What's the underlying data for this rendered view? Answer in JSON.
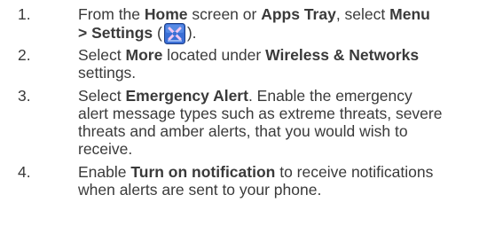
{
  "steps": [
    {
      "number": "1.",
      "lines": [
        {
          "parts": [
            {
              "t": "From the ",
              "b": false
            },
            {
              "t": "Home",
              "b": true
            },
            {
              "t": " screen or ",
              "b": false
            },
            {
              "t": "Apps Tray",
              "b": true
            },
            {
              "t": ", select ",
              "b": false
            },
            {
              "t": "Menu",
              "b": true
            }
          ]
        },
        {
          "parts": [
            {
              "t": "> Settings",
              "b": true
            },
            {
              "t": " (",
              "b": false
            },
            {
              "icon": "settings-icon"
            },
            {
              "t": ").",
              "b": false
            }
          ]
        }
      ]
    },
    {
      "number": "2.",
      "lines": [
        {
          "parts": [
            {
              "t": "Select ",
              "b": false
            },
            {
              "t": "More",
              "b": true
            },
            {
              "t": " located under ",
              "b": false
            },
            {
              "t": "Wireless & Networks",
              "b": true
            }
          ]
        },
        {
          "parts": [
            {
              "t": "settings.",
              "b": false
            }
          ]
        }
      ]
    },
    {
      "number": "3.",
      "lines": [
        {
          "parts": [
            {
              "t": "Select ",
              "b": false
            },
            {
              "t": "Emergency Alert",
              "b": true
            },
            {
              "t": ". Enable the emergency",
              "b": false
            }
          ]
        },
        {
          "parts": [
            {
              "t": "alert message types such as extreme threats, severe",
              "b": false
            }
          ]
        },
        {
          "parts": [
            {
              "t": "threats and amber alerts, that you would wish to",
              "b": false
            }
          ]
        },
        {
          "parts": [
            {
              "t": "receive.",
              "b": false
            }
          ]
        }
      ]
    },
    {
      "number": "4.",
      "lines": [
        {
          "parts": [
            {
              "t": "Enable ",
              "b": false
            },
            {
              "t": "Turn on notification",
              "b": true
            },
            {
              "t": " to receive notifications",
              "b": false
            }
          ]
        },
        {
          "parts": [
            {
              "t": "when alerts are sent to your phone.",
              "b": false
            }
          ]
        }
      ]
    }
  ],
  "colors": {
    "text": "#3a3a3a",
    "icon_bg": "#3b6fd6",
    "icon_glyph": "#f2c7f0"
  }
}
